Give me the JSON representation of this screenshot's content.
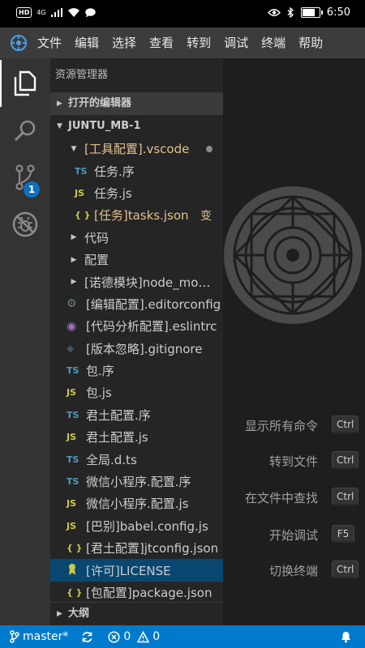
{
  "phone_status": {
    "network": "4G",
    "time": "6:50"
  },
  "menu": [
    "文件",
    "编辑",
    "选择",
    "查看",
    "转到",
    "调试",
    "终端",
    "帮助"
  ],
  "activity": {
    "scm_badge": "1"
  },
  "sidebar": {
    "title": "资源管理器",
    "open_editors": "打开的编辑器",
    "project": "JUNTU_MB-1",
    "outline": "大纲",
    "rows": [
      {
        "label": "[工具配置].vscode",
        "icon": "",
        "twisty": "▼"
      },
      {
        "label": "任务.序",
        "icon": "TS"
      },
      {
        "label": "任务.js",
        "icon": "JS"
      },
      {
        "label": "[任务]tasks.json",
        "icon": "{ }",
        "mod": "变"
      },
      {
        "label": "代码",
        "twisty": "▶"
      },
      {
        "label": "配置",
        "twisty": "▶"
      },
      {
        "label": "[诺德模块]node_mo…",
        "twisty": "▶"
      },
      {
        "label": "[编辑配置].editorconfig",
        "icon": "⚙"
      },
      {
        "label": "[代码分析配置].eslintrc",
        "icon": "◉"
      },
      {
        "label": "[版本忽略].gitignore",
        "icon": "◆"
      },
      {
        "label": "包.序",
        "icon": "TS"
      },
      {
        "label": "包.js",
        "icon": "JS"
      },
      {
        "label": "君土配置.序",
        "icon": "TS"
      },
      {
        "label": "君土配置.js",
        "icon": "JS"
      },
      {
        "label": "全局.d.ts",
        "icon": "TS"
      },
      {
        "label": "微信小程序.配置.序",
        "icon": "TS"
      },
      {
        "label": "微信小程序.配置.js",
        "icon": "JS"
      },
      {
        "label": "[巴别]babel.config.js",
        "icon": "JS"
      },
      {
        "label": "[君土配置]jtconfig.json",
        "icon": "{ }"
      },
      {
        "label": "[许可]LICENSE",
        "icon": "license"
      },
      {
        "label": "[包配置]package.json",
        "icon": "{ }"
      }
    ]
  },
  "shortcuts": [
    {
      "command": "显示所有命令",
      "key": "Ctrl"
    },
    {
      "command": "转到文件",
      "key": "Ctrl"
    },
    {
      "command": "在文件中查找",
      "key": "Ctrl"
    },
    {
      "command": "开始调试",
      "key": "F5"
    },
    {
      "command": "切换终端",
      "key": "Ctrl"
    }
  ],
  "statusbar": {
    "branch": "master*",
    "errors": "0",
    "warnings": "0"
  },
  "colors": {
    "accent": "#007acc",
    "selection": "#094771",
    "ts": "#519aba",
    "js": "#cbcb41"
  }
}
